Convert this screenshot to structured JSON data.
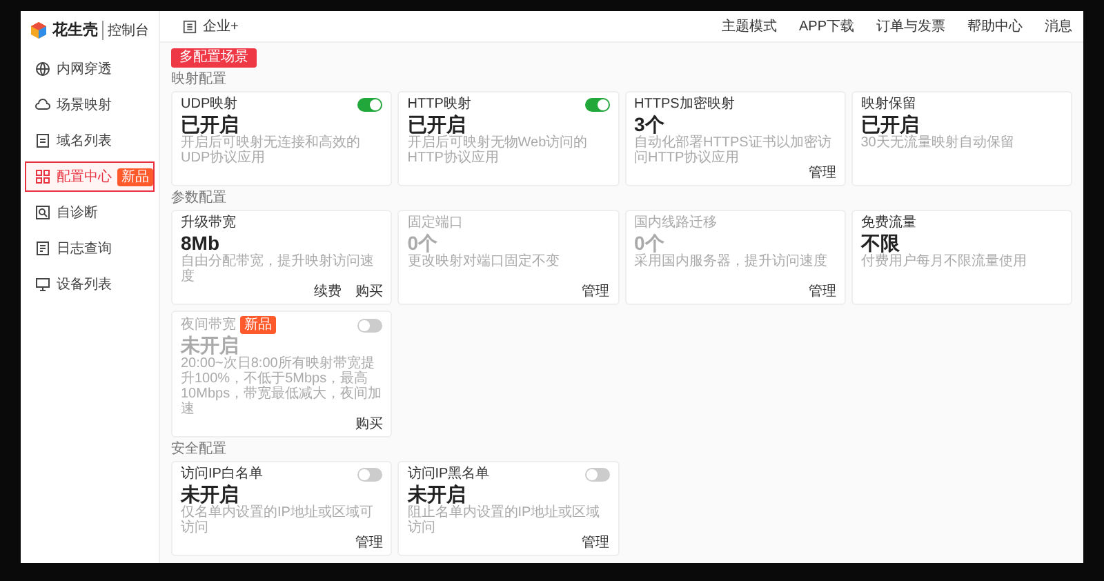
{
  "logo": {
    "brand": "花生壳",
    "product": "控制台"
  },
  "sidebar": {
    "items": [
      {
        "label": "内网穿透",
        "selected": false
      },
      {
        "label": "场景映射",
        "selected": false
      },
      {
        "label": "域名列表",
        "selected": false
      },
      {
        "label": "配置中心",
        "selected": true,
        "badge": "新品"
      },
      {
        "label": "自诊断",
        "selected": false
      },
      {
        "label": "日志查询",
        "selected": false
      },
      {
        "label": "设备列表",
        "selected": false
      }
    ]
  },
  "topbar": {
    "plan": "企业+",
    "links": [
      "主题模式",
      "APP下载",
      "订单与发票",
      "帮助中心",
      "消息"
    ]
  },
  "primary_button": "多配置场景",
  "sections": [
    {
      "title": "映射配置",
      "cards": [
        {
          "title": "UDP映射",
          "toggle": {
            "on": true
          },
          "value": "已开启",
          "desc": "开启后可映射无连接和高效的UDP协议应用",
          "disabled": false
        },
        {
          "title": "HTTP映射",
          "toggle": {
            "on": true
          },
          "value": "已开启",
          "desc": "开启后可映射无物Web访问的HTTP协议应用",
          "disabled": false
        },
        {
          "title": "HTTPS加密映射",
          "value": "3个",
          "desc": "自动化部署HTTPS证书以加密访问HTTP协议应用",
          "actions": [
            "管理"
          ],
          "disabled": false
        },
        {
          "title": "映射保留",
          "value": "已开启",
          "desc": "30天无流量映射自动保留",
          "disabled": false
        }
      ]
    },
    {
      "title": "参数配置",
      "cards": [
        {
          "title": "升级带宽",
          "value": "8Mb",
          "desc": "自由分配带宽，提升映射访问速度",
          "actions": [
            "续费",
            "购买"
          ],
          "disabled": false
        },
        {
          "title": "固定端口",
          "value": "0个",
          "desc": "更改映射对端口固定不变",
          "actions": [
            "管理"
          ],
          "disabled": true
        },
        {
          "title": "国内线路迁移",
          "value": "0个",
          "desc": "采用国内服务器，提升访问速度",
          "actions": [
            "管理"
          ],
          "disabled": true
        },
        {
          "title": "免费流量",
          "value": "不限",
          "desc": "付费用户每月不限流量使用",
          "disabled": false
        },
        {
          "title": "夜间带宽",
          "badge": "新品",
          "toggle": {
            "on": false
          },
          "value": "未开启",
          "desc": "20:00~次日8:00所有映射带宽提升100%，不低于5Mbps，最高10Mbps，带宽最低减大，夜间加速",
          "actions": [
            "购买"
          ],
          "disabled": true
        }
      ]
    },
    {
      "title": "安全配置",
      "cards": [
        {
          "title": "访问IP白名单",
          "toggle": {
            "on": false
          },
          "value": "未开启",
          "desc": "仅名单内设置的IP地址或区域可访问",
          "actions": [
            "管理"
          ],
          "disabled": false
        },
        {
          "title": "访问IP黑名单",
          "toggle": {
            "on": false
          },
          "value": "未开启",
          "desc": "阻止名单内设置的IP地址或区域访问",
          "actions": [
            "管理"
          ],
          "disabled": false
        }
      ]
    }
  ]
}
